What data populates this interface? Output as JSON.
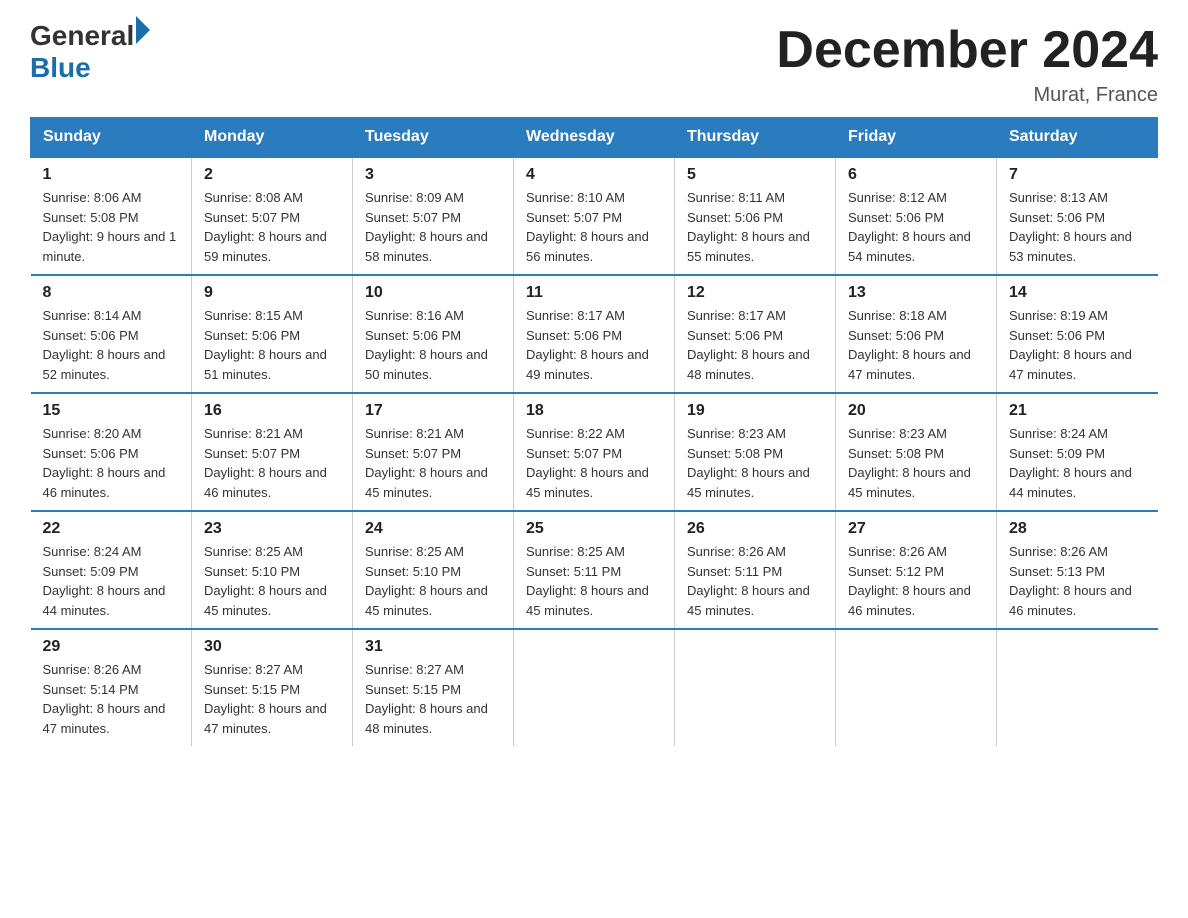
{
  "logo": {
    "general": "General",
    "blue": "Blue"
  },
  "title": "December 2024",
  "location": "Murat, France",
  "weekdays": [
    "Sunday",
    "Monday",
    "Tuesday",
    "Wednesday",
    "Thursday",
    "Friday",
    "Saturday"
  ],
  "weeks": [
    [
      {
        "day": "1",
        "sunrise": "8:06 AM",
        "sunset": "5:08 PM",
        "daylight": "9 hours and 1 minute."
      },
      {
        "day": "2",
        "sunrise": "8:08 AM",
        "sunset": "5:07 PM",
        "daylight": "8 hours and 59 minutes."
      },
      {
        "day": "3",
        "sunrise": "8:09 AM",
        "sunset": "5:07 PM",
        "daylight": "8 hours and 58 minutes."
      },
      {
        "day": "4",
        "sunrise": "8:10 AM",
        "sunset": "5:07 PM",
        "daylight": "8 hours and 56 minutes."
      },
      {
        "day": "5",
        "sunrise": "8:11 AM",
        "sunset": "5:06 PM",
        "daylight": "8 hours and 55 minutes."
      },
      {
        "day": "6",
        "sunrise": "8:12 AM",
        "sunset": "5:06 PM",
        "daylight": "8 hours and 54 minutes."
      },
      {
        "day": "7",
        "sunrise": "8:13 AM",
        "sunset": "5:06 PM",
        "daylight": "8 hours and 53 minutes."
      }
    ],
    [
      {
        "day": "8",
        "sunrise": "8:14 AM",
        "sunset": "5:06 PM",
        "daylight": "8 hours and 52 minutes."
      },
      {
        "day": "9",
        "sunrise": "8:15 AM",
        "sunset": "5:06 PM",
        "daylight": "8 hours and 51 minutes."
      },
      {
        "day": "10",
        "sunrise": "8:16 AM",
        "sunset": "5:06 PM",
        "daylight": "8 hours and 50 minutes."
      },
      {
        "day": "11",
        "sunrise": "8:17 AM",
        "sunset": "5:06 PM",
        "daylight": "8 hours and 49 minutes."
      },
      {
        "day": "12",
        "sunrise": "8:17 AM",
        "sunset": "5:06 PM",
        "daylight": "8 hours and 48 minutes."
      },
      {
        "day": "13",
        "sunrise": "8:18 AM",
        "sunset": "5:06 PM",
        "daylight": "8 hours and 47 minutes."
      },
      {
        "day": "14",
        "sunrise": "8:19 AM",
        "sunset": "5:06 PM",
        "daylight": "8 hours and 47 minutes."
      }
    ],
    [
      {
        "day": "15",
        "sunrise": "8:20 AM",
        "sunset": "5:06 PM",
        "daylight": "8 hours and 46 minutes."
      },
      {
        "day": "16",
        "sunrise": "8:21 AM",
        "sunset": "5:07 PM",
        "daylight": "8 hours and 46 minutes."
      },
      {
        "day": "17",
        "sunrise": "8:21 AM",
        "sunset": "5:07 PM",
        "daylight": "8 hours and 45 minutes."
      },
      {
        "day": "18",
        "sunrise": "8:22 AM",
        "sunset": "5:07 PM",
        "daylight": "8 hours and 45 minutes."
      },
      {
        "day": "19",
        "sunrise": "8:23 AM",
        "sunset": "5:08 PM",
        "daylight": "8 hours and 45 minutes."
      },
      {
        "day": "20",
        "sunrise": "8:23 AM",
        "sunset": "5:08 PM",
        "daylight": "8 hours and 45 minutes."
      },
      {
        "day": "21",
        "sunrise": "8:24 AM",
        "sunset": "5:09 PM",
        "daylight": "8 hours and 44 minutes."
      }
    ],
    [
      {
        "day": "22",
        "sunrise": "8:24 AM",
        "sunset": "5:09 PM",
        "daylight": "8 hours and 44 minutes."
      },
      {
        "day": "23",
        "sunrise": "8:25 AM",
        "sunset": "5:10 PM",
        "daylight": "8 hours and 45 minutes."
      },
      {
        "day": "24",
        "sunrise": "8:25 AM",
        "sunset": "5:10 PM",
        "daylight": "8 hours and 45 minutes."
      },
      {
        "day": "25",
        "sunrise": "8:25 AM",
        "sunset": "5:11 PM",
        "daylight": "8 hours and 45 minutes."
      },
      {
        "day": "26",
        "sunrise": "8:26 AM",
        "sunset": "5:11 PM",
        "daylight": "8 hours and 45 minutes."
      },
      {
        "day": "27",
        "sunrise": "8:26 AM",
        "sunset": "5:12 PM",
        "daylight": "8 hours and 46 minutes."
      },
      {
        "day": "28",
        "sunrise": "8:26 AM",
        "sunset": "5:13 PM",
        "daylight": "8 hours and 46 minutes."
      }
    ],
    [
      {
        "day": "29",
        "sunrise": "8:26 AM",
        "sunset": "5:14 PM",
        "daylight": "8 hours and 47 minutes."
      },
      {
        "day": "30",
        "sunrise": "8:27 AM",
        "sunset": "5:15 PM",
        "daylight": "8 hours and 47 minutes."
      },
      {
        "day": "31",
        "sunrise": "8:27 AM",
        "sunset": "5:15 PM",
        "daylight": "8 hours and 48 minutes."
      },
      null,
      null,
      null,
      null
    ]
  ]
}
